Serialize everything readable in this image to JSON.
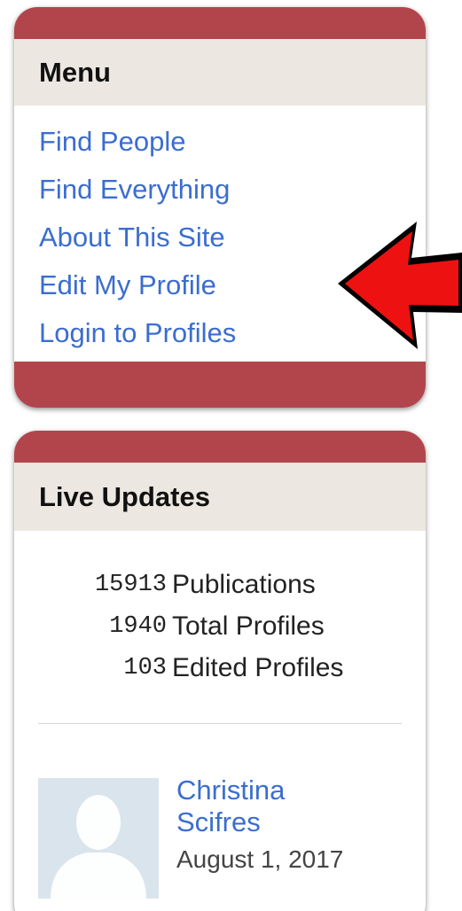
{
  "menu": {
    "title": "Menu",
    "items": [
      {
        "label": "Find People"
      },
      {
        "label": "Find Everything"
      },
      {
        "label": "About This Site"
      },
      {
        "label": "Edit My Profile"
      },
      {
        "label": "Login to Profiles"
      }
    ]
  },
  "live_updates": {
    "title": "Live Updates",
    "stats": [
      {
        "count": "15913",
        "label": "Publications"
      },
      {
        "count": "1940",
        "label": "Total Profiles"
      },
      {
        "count": "103",
        "label": "Edited Profiles"
      }
    ],
    "recent": {
      "name": "Christina Scifres",
      "date": "August 1, 2017"
    }
  },
  "colors": {
    "panel_accent": "#b2454c",
    "header_bg": "#ece7e0",
    "link": "#3b6dcf",
    "arrow_fill": "#ee1111"
  },
  "icons": {
    "arrow": "red-left-arrow-icon",
    "avatar": "default-person-silhouette-icon"
  }
}
